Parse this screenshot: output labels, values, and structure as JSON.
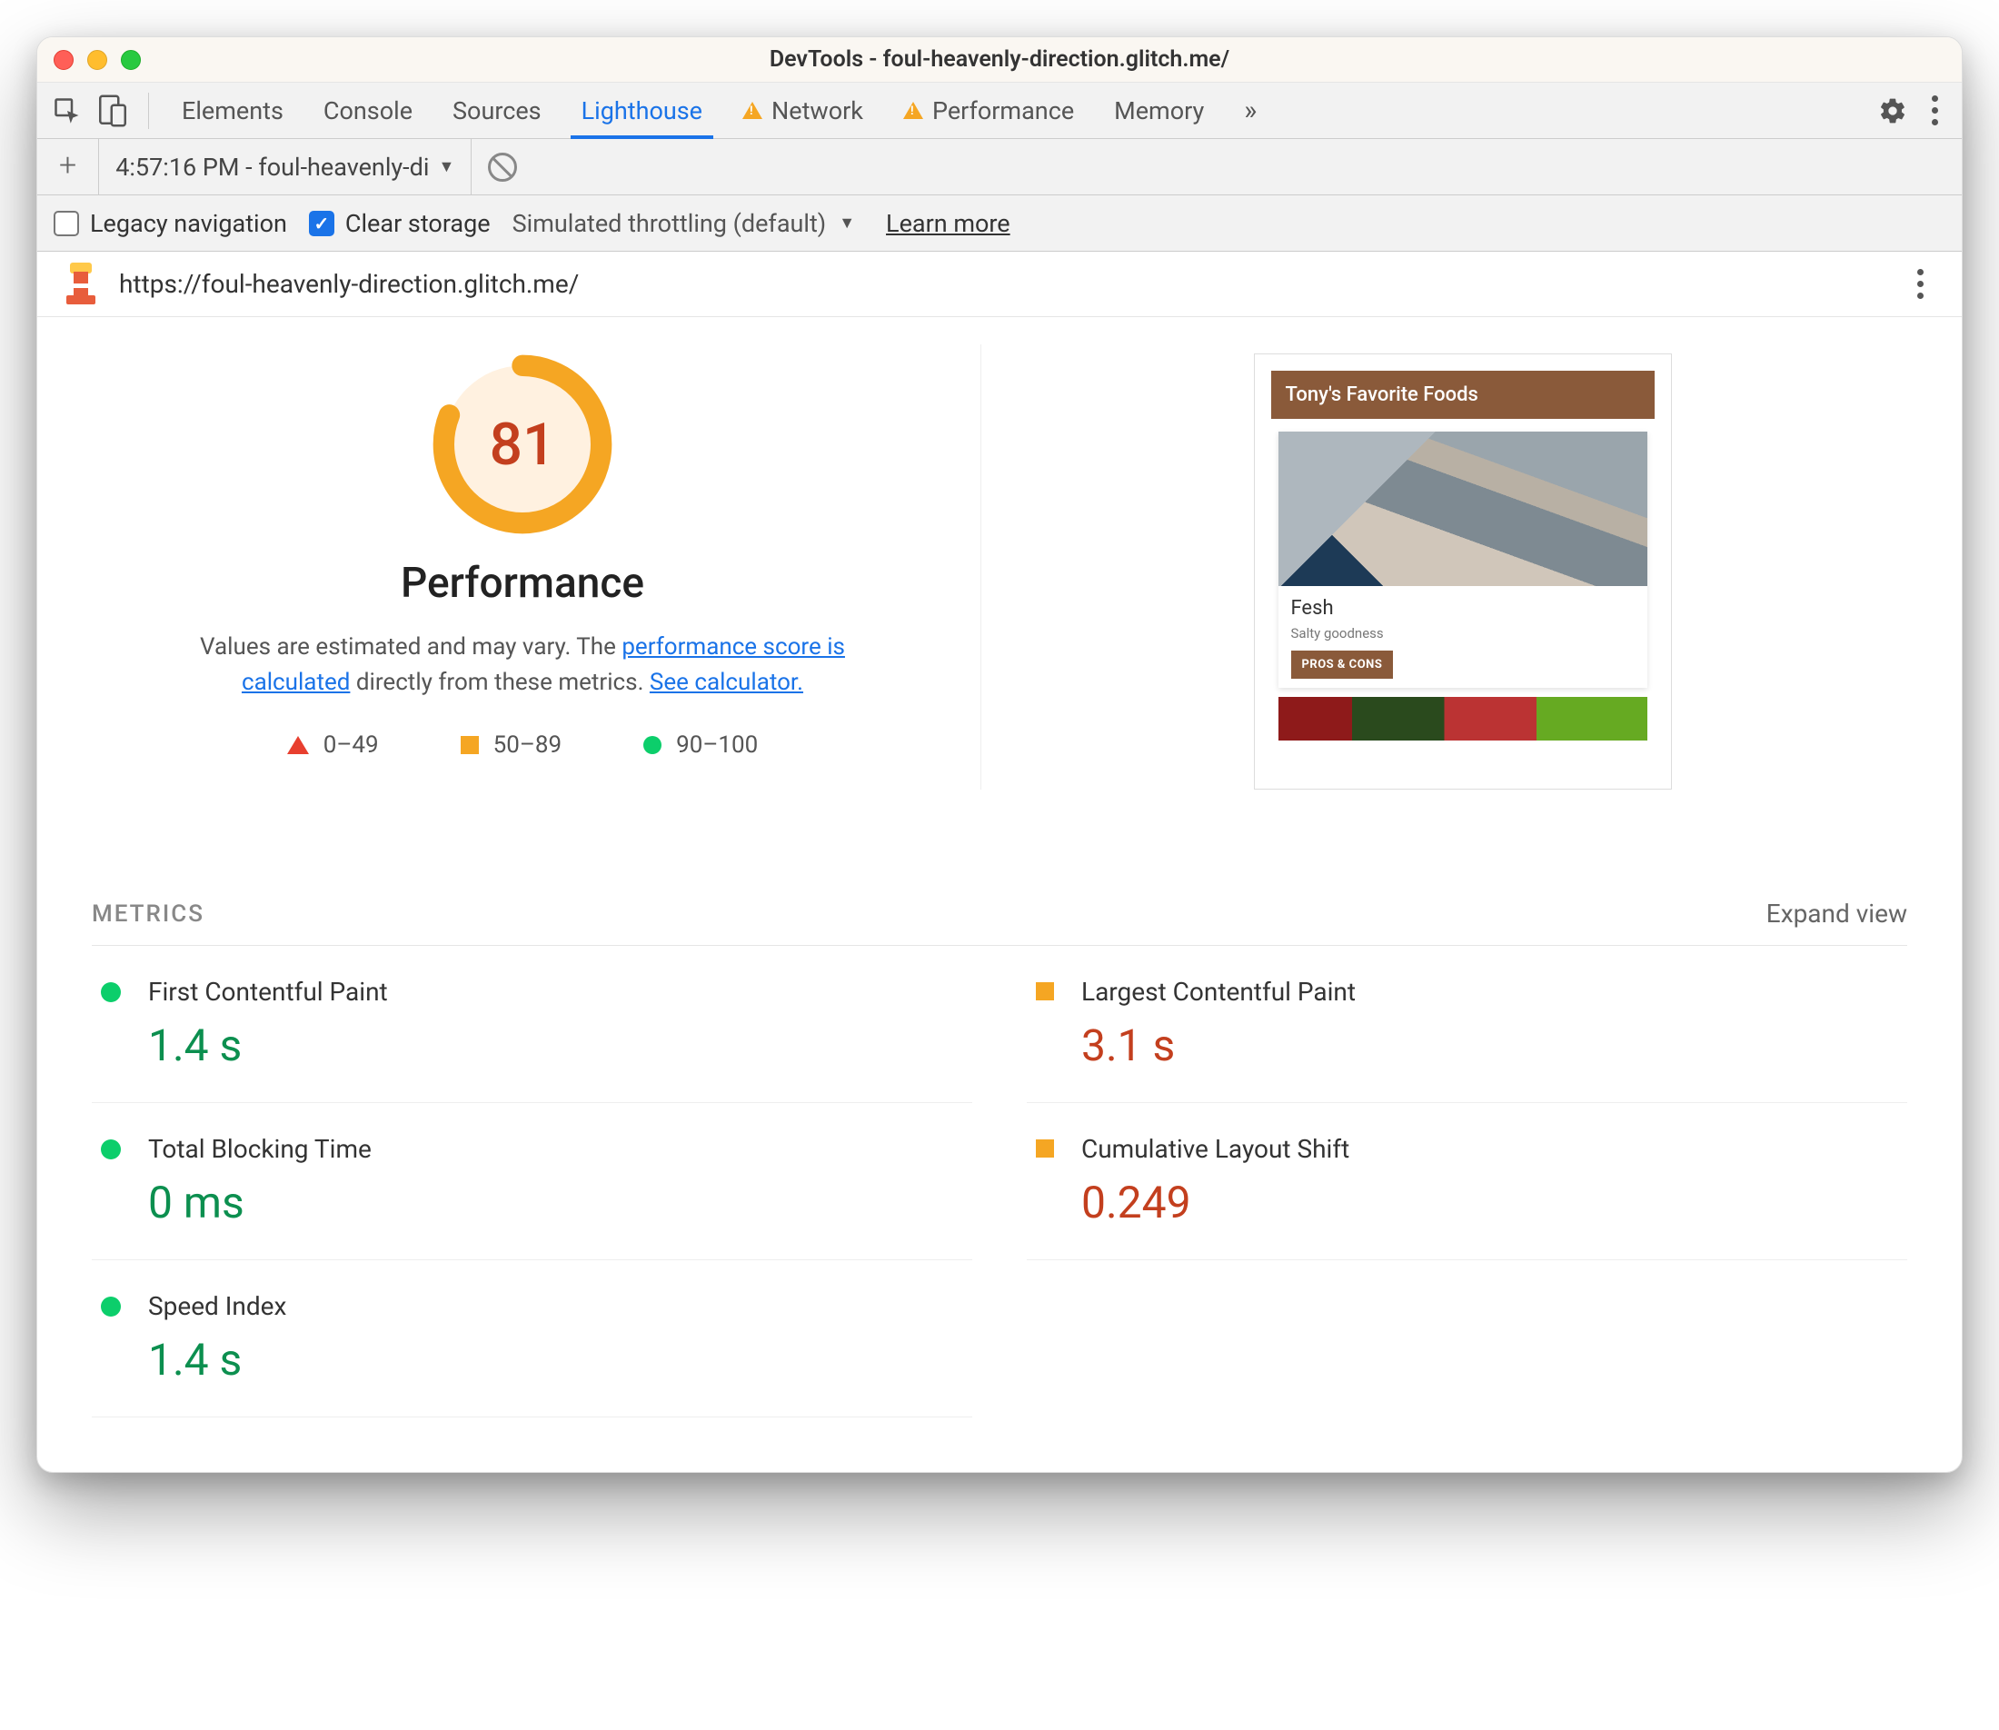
{
  "window": {
    "title": "DevTools - foul-heavenly-direction.glitch.me/"
  },
  "tabs": {
    "items": [
      "Elements",
      "Console",
      "Sources",
      "Lighthouse",
      "Network",
      "Performance",
      "Memory"
    ],
    "selected": "Lighthouse",
    "warn": [
      "Network",
      "Performance"
    ]
  },
  "runbar": {
    "run_label": "4:57:16 PM - foul-heavenly-di"
  },
  "options": {
    "legacy_label": "Legacy navigation",
    "legacy_checked": false,
    "clear_label": "Clear storage",
    "clear_checked": true,
    "throttle_label": "Simulated throttling (default)",
    "learn_label": "Learn more"
  },
  "url": "https://foul-heavenly-direction.glitch.me/",
  "report": {
    "score": "81",
    "category": "Performance",
    "desc_pre": "Values are estimated and may vary. The ",
    "desc_link1": "performance score is calculated",
    "desc_mid": " directly from these metrics. ",
    "desc_link2": "See calculator.",
    "legend": {
      "fail": "0–49",
      "avg": "50–89",
      "pass": "90–100"
    }
  },
  "thumbnail": {
    "header": "Tony's Favorite Foods",
    "card_title": "Fesh",
    "card_sub": "Salty goodness",
    "card_btn": "PROS & CONS"
  },
  "metrics": {
    "heading": "METRICS",
    "expand": "Expand view",
    "items": [
      {
        "label": "First Contentful Paint",
        "value": "1.4 s",
        "status": "green"
      },
      {
        "label": "Largest Contentful Paint",
        "value": "3.1 s",
        "status": "orange"
      },
      {
        "label": "Total Blocking Time",
        "value": "0 ms",
        "status": "green"
      },
      {
        "label": "Cumulative Layout Shift",
        "value": "0.249",
        "status": "orange"
      },
      {
        "label": "Speed Index",
        "value": "1.4 s",
        "status": "green"
      }
    ]
  },
  "chart_data": {
    "type": "table",
    "title": "Lighthouse Performance Metrics",
    "overall_score": 81,
    "scale": {
      "fail": "0–49",
      "average": "50–89",
      "pass": "90–100"
    },
    "series": [
      {
        "name": "First Contentful Paint",
        "value": 1.4,
        "unit": "s",
        "rating": "pass"
      },
      {
        "name": "Largest Contentful Paint",
        "value": 3.1,
        "unit": "s",
        "rating": "average"
      },
      {
        "name": "Total Blocking Time",
        "value": 0,
        "unit": "ms",
        "rating": "pass"
      },
      {
        "name": "Cumulative Layout Shift",
        "value": 0.249,
        "unit": "",
        "rating": "average"
      },
      {
        "name": "Speed Index",
        "value": 1.4,
        "unit": "s",
        "rating": "pass"
      }
    ]
  }
}
